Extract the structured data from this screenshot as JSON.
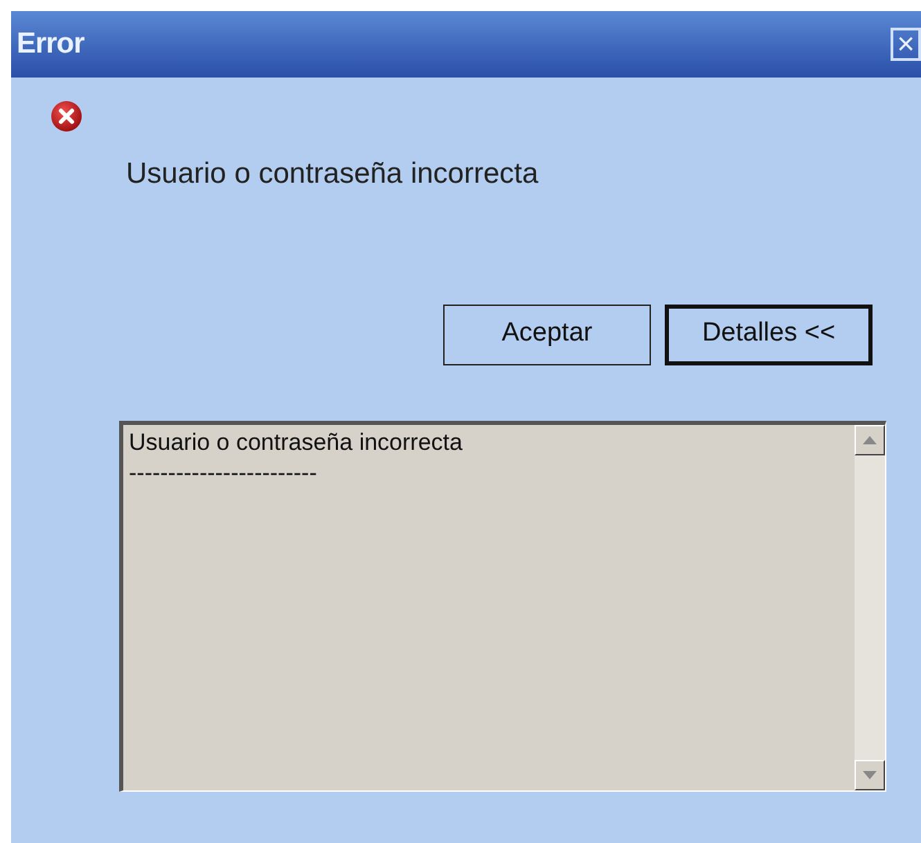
{
  "window": {
    "title": "Error",
    "close": "×"
  },
  "message": "Usuario o contraseña incorrecta",
  "buttons": [
    {
      "label": "Aceptar",
      "focused": false
    },
    {
      "label": "Detalles <<",
      "focused": true
    }
  ],
  "details": {
    "lines": [
      "Usuario o contraseña incorrecta",
      "------------------------"
    ]
  }
}
